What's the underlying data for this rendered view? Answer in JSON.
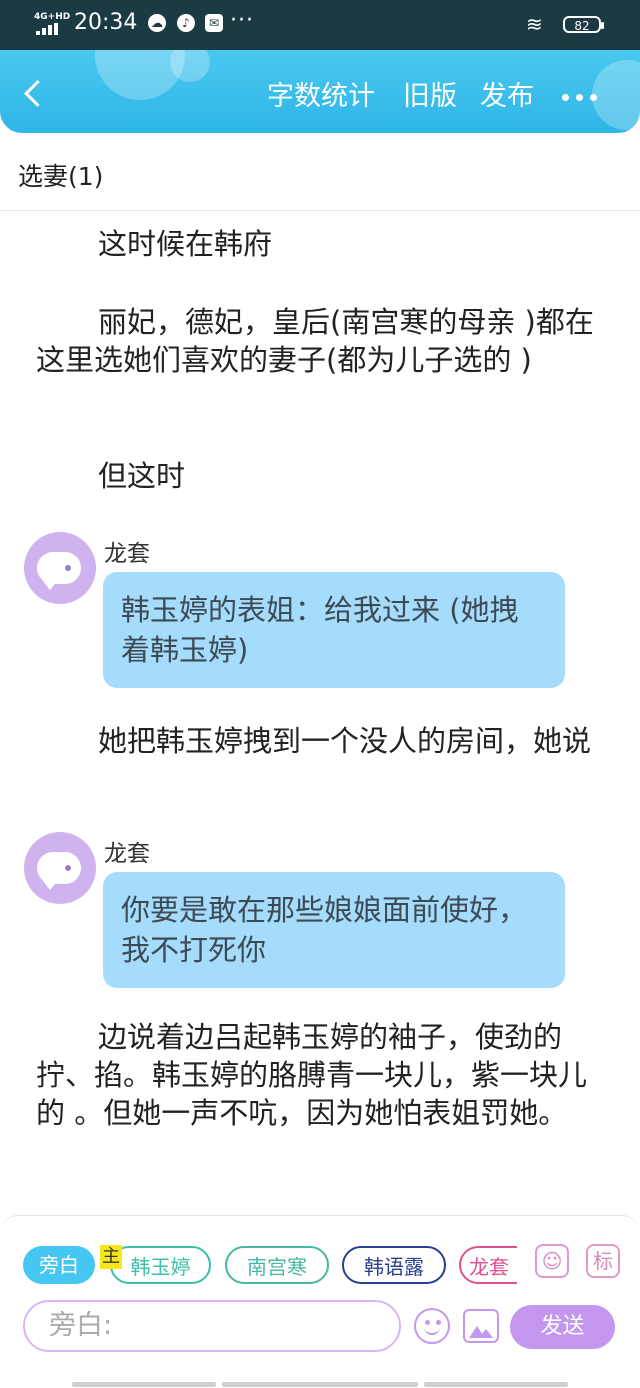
{
  "status_bar": {
    "network": "4G+HD",
    "time": "20:34",
    "more": "···",
    "battery": "82"
  },
  "header": {
    "word_count_label": "字数统计",
    "old_version_label": "旧版",
    "publish_label": "发布"
  },
  "chapter": {
    "title": "选妻(1)"
  },
  "content": {
    "p1": "这时候在韩府",
    "p2": "丽妃，德妃，皇后(南宫寒的母亲 )都在这里选她们喜欢的妻子(都为儿子选的 )",
    "p3": "但这时",
    "msg1_speaker": "龙套",
    "msg1_text": "韩玉婷的表姐：给我过来 (她拽着韩玉婷)",
    "p4": "她把韩玉婷拽到一个没人的房间，她说",
    "msg2_speaker": "龙套",
    "msg2_text": "你要是敢在那些娘娘面前使好，我不打死你",
    "p5": "边说着边吕起韩玉婷的袖子，使劲的拧、掐。韩玉婷的胳膊青一块儿，紫一块儿的 。但她一声不吭，因为她怕表姐罚她。"
  },
  "input_panel": {
    "roles": [
      {
        "label": "旁白",
        "color": "#46c7f2"
      },
      {
        "label": "韩玉婷",
        "color": "#3cbfa6"
      },
      {
        "label": "南宫寒",
        "color": "#48b7a2"
      },
      {
        "label": "韩语露",
        "color": "#2a3f8f"
      },
      {
        "label": "龙套",
        "color": "#e0508f"
      }
    ],
    "main_tag": "主",
    "mark_label": "标",
    "input_placeholder": "旁白:",
    "send_label": "发送"
  },
  "colors": {
    "header_bg": "#2fb5e8",
    "bubble_bg": "#a6dcfb",
    "accent_purple": "#c497ee",
    "avatar_bg": "#cfb3ef"
  }
}
